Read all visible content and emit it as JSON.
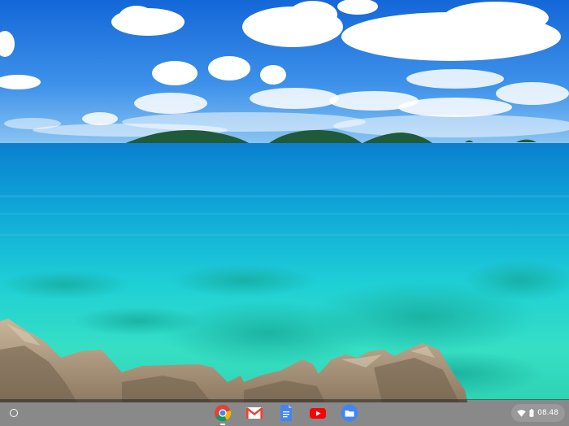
{
  "shelf": {
    "launcher_icon": "launcher-circle-icon",
    "apps": [
      {
        "icon": "chrome-icon",
        "color": "#DB4437",
        "running": true
      },
      {
        "icon": "gmail-icon",
        "color": "#EA4335",
        "running": false
      },
      {
        "icon": "google-docs-icon",
        "color": "#4285F4",
        "running": false
      },
      {
        "icon": "youtube-icon",
        "color": "#FF0000",
        "running": false
      },
      {
        "icon": "files-icon",
        "color": "#4285F4",
        "running": false
      }
    ],
    "tray": {
      "wifi_icon": "wifi-icon",
      "battery_icon": "battery-icon",
      "time": "08.48"
    }
  },
  "colors": {
    "sky": "#1E78E6",
    "sea": "#12B4D6",
    "lagoon": "#38E2D0",
    "shelf_bg": "#333333"
  }
}
